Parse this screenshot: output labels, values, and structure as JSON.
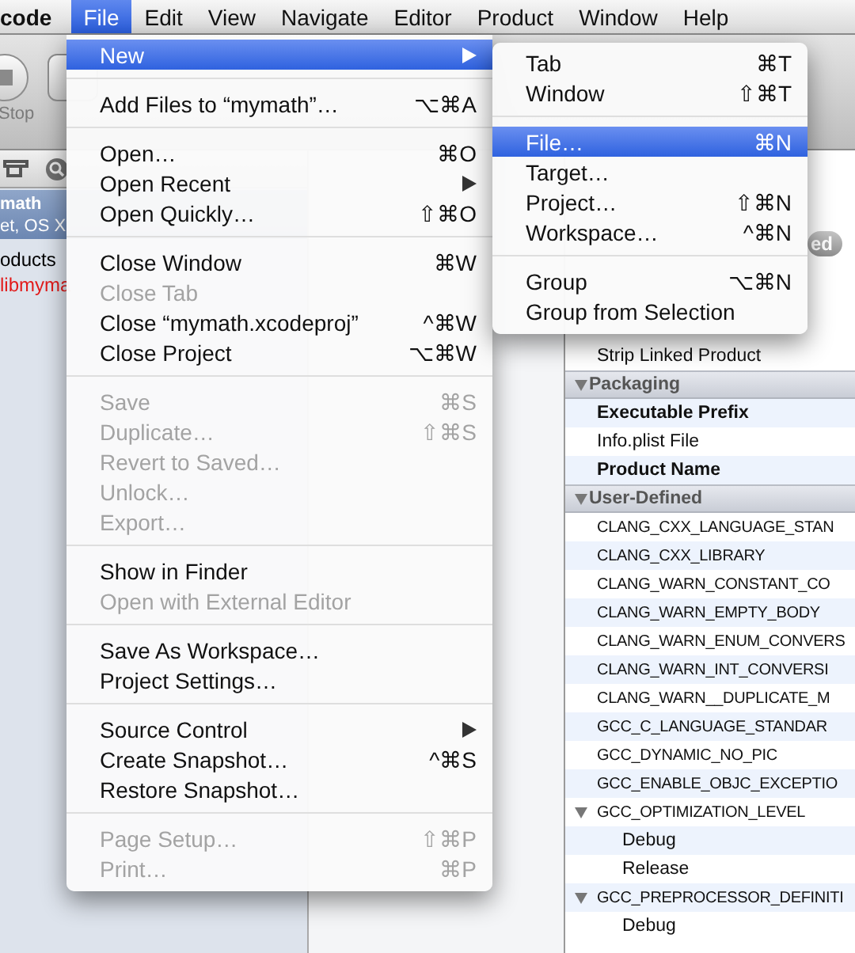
{
  "menu_bar": {
    "items": [
      {
        "kind": "app",
        "label": "code",
        "selected": false
      },
      {
        "kind": "menu",
        "label": "File",
        "selected": true
      },
      {
        "kind": "menu",
        "label": "Edit",
        "selected": false
      },
      {
        "kind": "menu",
        "label": "View",
        "selected": false
      },
      {
        "kind": "menu",
        "label": "Navigate",
        "selected": false
      },
      {
        "kind": "menu",
        "label": "Editor",
        "selected": false
      },
      {
        "kind": "menu",
        "label": "Product",
        "selected": false
      },
      {
        "kind": "menu",
        "label": "Window",
        "selected": false
      },
      {
        "kind": "menu",
        "label": "Help",
        "selected": false
      }
    ]
  },
  "toolbar": {
    "stop_button": {
      "label": "Stop"
    }
  },
  "navigator": {
    "items": [
      {
        "kind": "project",
        "title": "math",
        "subtitle": "et, OS X",
        "selected": true
      },
      {
        "kind": "group",
        "title": "oducts",
        "selected": false
      },
      {
        "kind": "missing_product",
        "title": "libmyma",
        "selected": false
      }
    ]
  },
  "editor": {
    "segment_label": "ed"
  },
  "build_settings": [
    {
      "kind": "setting",
      "name": "Strip Linked Product",
      "modified": false
    },
    {
      "kind": "group",
      "name": "Packaging",
      "expanded": true,
      "children": [
        {
          "kind": "setting",
          "name": "Executable Prefix",
          "modified": true
        },
        {
          "kind": "setting",
          "name": "Info.plist File",
          "modified": false
        },
        {
          "kind": "setting",
          "name": "Product Name",
          "modified": true
        }
      ]
    },
    {
      "kind": "group",
      "name": "User-Defined",
      "expanded": true,
      "children": [
        {
          "kind": "setting",
          "name": "CLANG_CXX_LANGUAGE_STAN",
          "modified": false
        },
        {
          "kind": "setting",
          "name": "CLANG_CXX_LIBRARY",
          "modified": false
        },
        {
          "kind": "setting",
          "name": "CLANG_WARN_CONSTANT_CO",
          "modified": false
        },
        {
          "kind": "setting",
          "name": "CLANG_WARN_EMPTY_BODY",
          "modified": false
        },
        {
          "kind": "setting",
          "name": "CLANG_WARN_ENUM_CONVERS",
          "modified": false
        },
        {
          "kind": "setting",
          "name": "CLANG_WARN_INT_CONVERSI",
          "modified": false
        },
        {
          "kind": "setting",
          "name": "CLANG_WARN__DUPLICATE_M",
          "modified": false
        },
        {
          "kind": "setting",
          "name": "GCC_C_LANGUAGE_STANDAR",
          "modified": false
        },
        {
          "kind": "setting",
          "name": "GCC_DYNAMIC_NO_PIC",
          "modified": false
        },
        {
          "kind": "setting",
          "name": "GCC_ENABLE_OBJC_EXCEPTIO",
          "modified": false
        },
        {
          "kind": "setting",
          "name": "GCC_OPTIMIZATION_LEVEL",
          "modified": false,
          "expanded": true,
          "children": [
            {
              "kind": "config",
              "name": "Debug"
            },
            {
              "kind": "config",
              "name": "Release"
            }
          ]
        },
        {
          "kind": "setting",
          "name": "GCC_PREPROCESSOR_DEFINITI",
          "modified": false,
          "expanded": true,
          "children": [
            {
              "kind": "config",
              "name": "Debug"
            }
          ]
        }
      ]
    }
  ],
  "file_menu": {
    "items": [
      {
        "kind": "item",
        "label": "New",
        "selected": true,
        "disabled": false,
        "submenu": true
      },
      {
        "kind": "separator"
      },
      {
        "kind": "item",
        "label": "Add Files to “mymath”…",
        "shortcut": "⌥⌘A",
        "selected": false,
        "disabled": false,
        "submenu": false
      },
      {
        "kind": "separator"
      },
      {
        "kind": "item",
        "label": "Open…",
        "shortcut": "⌘O",
        "selected": false,
        "disabled": false,
        "submenu": false
      },
      {
        "kind": "item",
        "label": "Open Recent",
        "selected": false,
        "disabled": false,
        "submenu": true
      },
      {
        "kind": "item",
        "label": "Open Quickly…",
        "shortcut": "⇧⌘O",
        "selected": false,
        "disabled": false,
        "submenu": false
      },
      {
        "kind": "separator"
      },
      {
        "kind": "item",
        "label": "Close Window",
        "shortcut": "⌘W",
        "selected": false,
        "disabled": false,
        "submenu": false
      },
      {
        "kind": "item",
        "label": "Close Tab",
        "selected": false,
        "disabled": true,
        "submenu": false
      },
      {
        "kind": "item",
        "label": "Close “mymath.xcodeproj”",
        "shortcut": "^⌘W",
        "selected": false,
        "disabled": false,
        "submenu": false
      },
      {
        "kind": "item",
        "label": "Close Project",
        "shortcut": "⌥⌘W",
        "selected": false,
        "disabled": false,
        "submenu": false
      },
      {
        "kind": "separator"
      },
      {
        "kind": "item",
        "label": "Save",
        "shortcut": "⌘S",
        "selected": false,
        "disabled": true,
        "submenu": false
      },
      {
        "kind": "item",
        "label": "Duplicate…",
        "shortcut": "⇧⌘S",
        "selected": false,
        "disabled": true,
        "submenu": false
      },
      {
        "kind": "item",
        "label": "Revert to Saved…",
        "selected": false,
        "disabled": true,
        "submenu": false
      },
      {
        "kind": "item",
        "label": "Unlock…",
        "selected": false,
        "disabled": true,
        "submenu": false
      },
      {
        "kind": "item",
        "label": "Export…",
        "selected": false,
        "disabled": true,
        "submenu": false
      },
      {
        "kind": "separator"
      },
      {
        "kind": "item",
        "label": "Show in Finder",
        "selected": false,
        "disabled": false,
        "submenu": false
      },
      {
        "kind": "item",
        "label": "Open with External Editor",
        "selected": false,
        "disabled": true,
        "submenu": false
      },
      {
        "kind": "separator"
      },
      {
        "kind": "item",
        "label": "Save As Workspace…",
        "selected": false,
        "disabled": false,
        "submenu": false
      },
      {
        "kind": "item",
        "label": "Project Settings…",
        "selected": false,
        "disabled": false,
        "submenu": false
      },
      {
        "kind": "separator"
      },
      {
        "kind": "item",
        "label": "Source Control",
        "selected": false,
        "disabled": false,
        "submenu": true
      },
      {
        "kind": "item",
        "label": "Create Snapshot…",
        "shortcut": "^⌘S",
        "selected": false,
        "disabled": false,
        "submenu": false
      },
      {
        "kind": "item",
        "label": "Restore Snapshot…",
        "selected": false,
        "disabled": false,
        "submenu": false
      },
      {
        "kind": "separator"
      },
      {
        "kind": "item",
        "label": "Page Setup…",
        "shortcut": "⇧⌘P",
        "selected": false,
        "disabled": true,
        "submenu": false
      },
      {
        "kind": "item",
        "label": "Print…",
        "shortcut": "⌘P",
        "selected": false,
        "disabled": true,
        "submenu": false
      }
    ]
  },
  "new_submenu": {
    "items": [
      {
        "kind": "item",
        "label": "Tab",
        "shortcut": "⌘T",
        "selected": false,
        "disabled": false,
        "submenu": false
      },
      {
        "kind": "item",
        "label": "Window",
        "shortcut": "⇧⌘T",
        "selected": false,
        "disabled": false,
        "submenu": false
      },
      {
        "kind": "separator"
      },
      {
        "kind": "item",
        "label": "File…",
        "shortcut": "⌘N",
        "selected": true,
        "disabled": false,
        "submenu": false
      },
      {
        "kind": "item",
        "label": "Target…",
        "selected": false,
        "disabled": false,
        "submenu": false
      },
      {
        "kind": "item",
        "label": "Project…",
        "shortcut": "⇧⌘N",
        "selected": false,
        "disabled": false,
        "submenu": false
      },
      {
        "kind": "item",
        "label": "Workspace…",
        "shortcut": "^⌘N",
        "selected": false,
        "disabled": false,
        "submenu": false
      },
      {
        "kind": "separator"
      },
      {
        "kind": "item",
        "label": "Group",
        "shortcut": "⌥⌘N",
        "selected": false,
        "disabled": false,
        "submenu": false
      },
      {
        "kind": "item",
        "label": "Group from Selection",
        "selected": false,
        "disabled": false,
        "submenu": false
      }
    ]
  }
}
